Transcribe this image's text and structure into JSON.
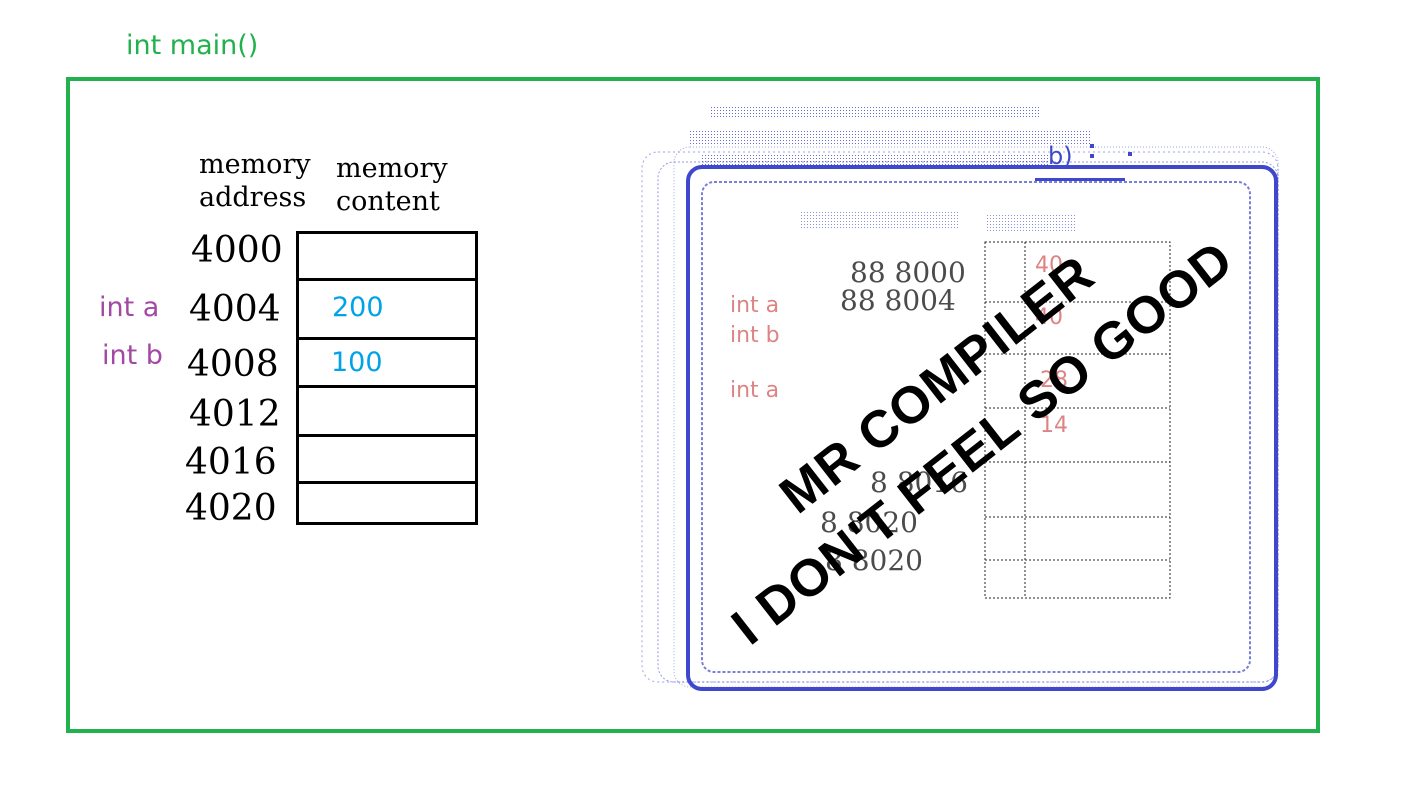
{
  "title": "int main()",
  "headers": {
    "address": [
      "memory",
      "address"
    ],
    "content": [
      "memory",
      "content"
    ]
  },
  "addresses": [
    "4000",
    "4004",
    "4008",
    "4012",
    "4016",
    "4020"
  ],
  "variables": {
    "a": "int a",
    "b": "int b"
  },
  "values": {
    "a": "200",
    "b": "100"
  },
  "stamp": [
    "MR COMPILER",
    "I DON'T FEEL SO GOOD"
  ],
  "colors": {
    "frame": "#22b14c",
    "variable": "#a349a4",
    "value": "#00a2e8",
    "ghost": "#3f48cc"
  }
}
